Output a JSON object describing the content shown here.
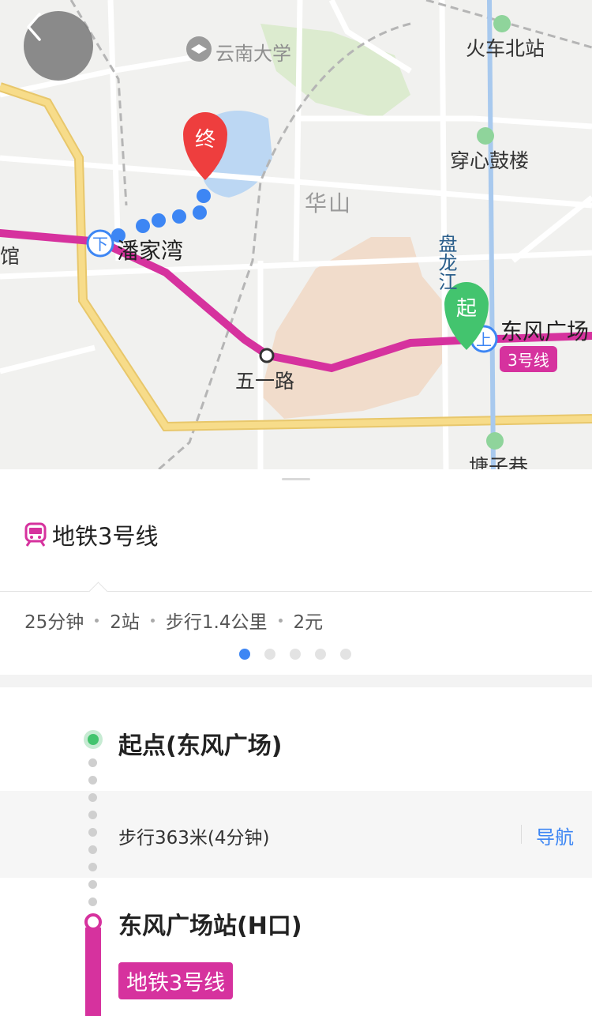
{
  "map": {
    "poi": {
      "yunnan_university": "云南大学",
      "huoche_beizhan": "火车北站",
      "chuanxin_gulou": "穿心鼓楼",
      "huashan": "华山",
      "panjiawan": "潘家湾",
      "wuyilu": "五一路",
      "dongfeng_guangchang": "东风广场",
      "panlong_jiang": "盘龙江",
      "tangzi_xiang": "塘子巷",
      "edge_guan": "馆"
    },
    "markers": {
      "end": "终",
      "start": "起",
      "alight": "下",
      "board": "上"
    },
    "line_badge": "3号线",
    "colors": {
      "metro_line": "#d6329e",
      "walk_dots": "#3d86f4",
      "start_marker": "#43c46e",
      "end_marker": "#ee3e3e",
      "ring_road": "#f7dc8a"
    }
  },
  "sheet": {
    "route_title": "地铁3号线",
    "summary": {
      "time": "25分钟",
      "stops": "2站",
      "walk": "步行1.4公里",
      "fare": "2元"
    },
    "pager": {
      "count": 5,
      "active_index": 0
    },
    "steps": {
      "origin": "起点(东风广场)",
      "walk": "步行363米(4分钟)",
      "nav": "导航",
      "station": "东风广场站(H口)",
      "line": "地铁3号线"
    }
  }
}
